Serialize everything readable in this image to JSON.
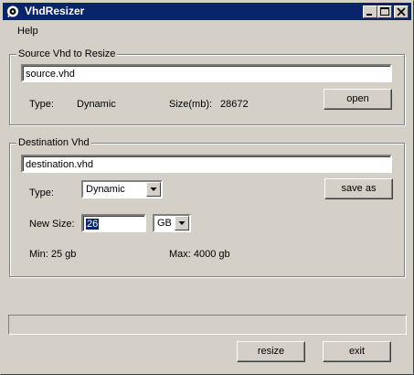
{
  "window": {
    "title": "VhdResizer",
    "icons": {
      "app": "app-icon",
      "minimize": "minimize-icon",
      "maximize": "maximize-icon",
      "close": "close-icon"
    }
  },
  "menu": {
    "items": [
      "Help"
    ]
  },
  "source": {
    "group_label": "Source Vhd to Resize",
    "path_value": "source.vhd",
    "type_label": "Type:",
    "type_value": "Dynamic",
    "size_label": "Size(mb):",
    "size_value": "28672",
    "open_label": "open"
  },
  "destination": {
    "group_label": "Destination Vhd",
    "path_value": "destination.vhd",
    "type_label": "Type:",
    "type_selected": "Dynamic",
    "save_as_label": "save as",
    "new_size_label": "New Size:",
    "new_size_value": "26",
    "unit_selected": "GB",
    "min_text": "Min: 25 gb",
    "max_text": "Max: 4000 gb"
  },
  "progress": {
    "fraction": 0
  },
  "actions": {
    "resize_label": "resize",
    "exit_label": "exit"
  },
  "colors": {
    "titlebar": "#0a246a",
    "face": "#d4d0c8",
    "selection": "#0a246a"
  }
}
